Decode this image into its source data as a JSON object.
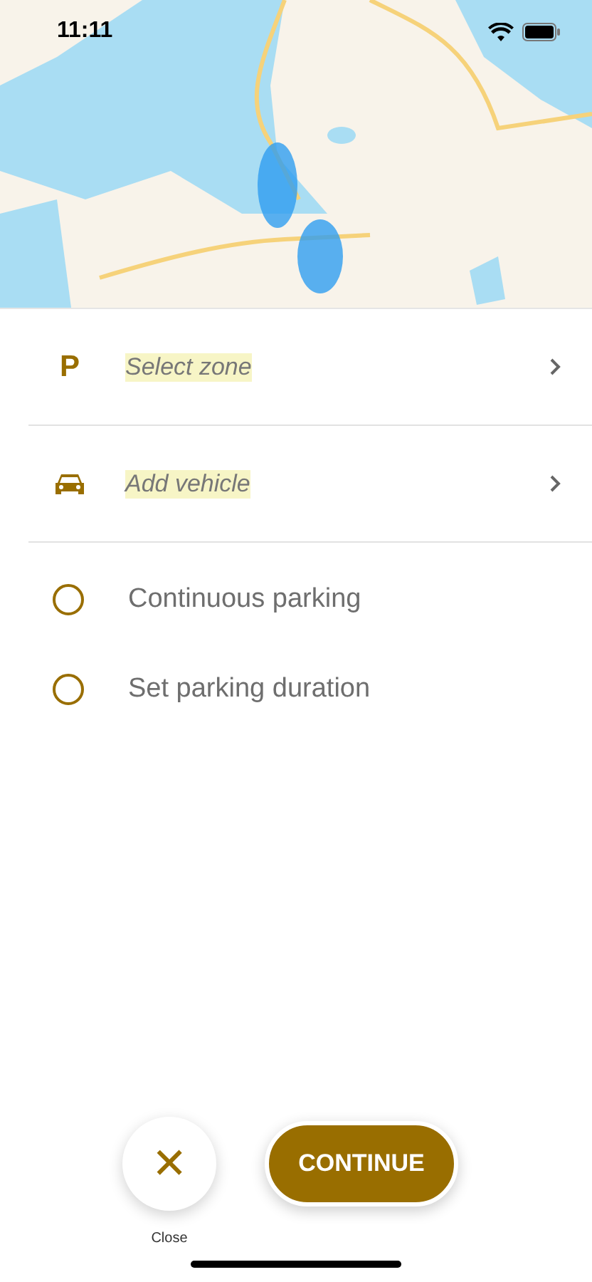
{
  "status_bar": {
    "time": "11:11"
  },
  "list_rows": [
    {
      "kind": "letter",
      "icon_text": "P",
      "placeholder": "Select zone"
    },
    {
      "kind": "car",
      "placeholder": "Add vehicle"
    }
  ],
  "options": [
    {
      "label": "Continuous parking",
      "selected": false
    },
    {
      "label": "Set parking duration",
      "selected": false
    }
  ],
  "close_button": {
    "icon_text": "✕",
    "label": "Close"
  },
  "continue_button": {
    "label": "CONTINUE"
  }
}
